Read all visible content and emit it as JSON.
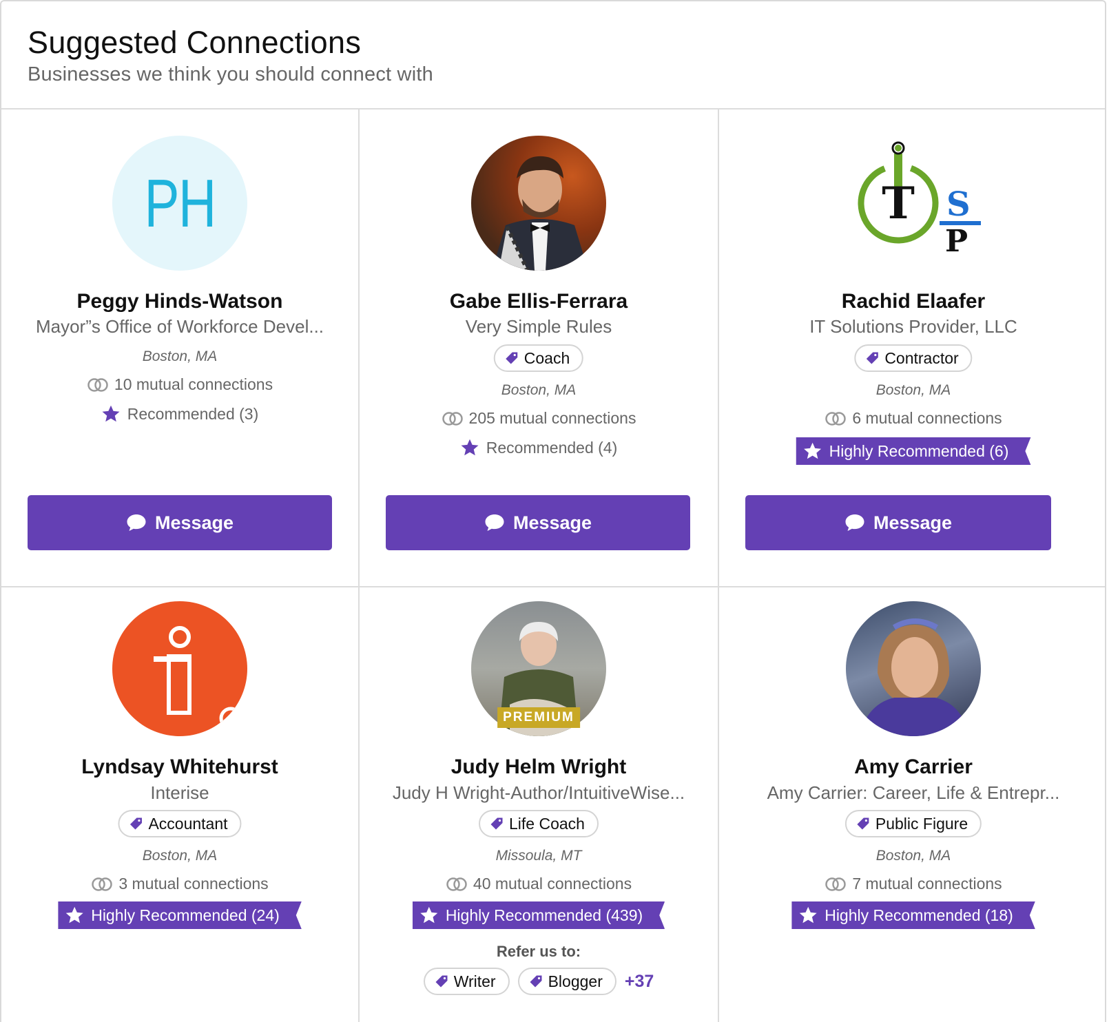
{
  "header": {
    "title": "Suggested Connections",
    "subtitle": "Businesses we think you should connect with"
  },
  "colors": {
    "accent": "#6440b4",
    "premium": "#c8a826",
    "text_muted": "#666666"
  },
  "message_label": "Message",
  "cards": [
    {
      "name": "Peggy Hinds-Watson",
      "org": "Mayor”s Office of Workforce Devel...",
      "location": "Boston, MA",
      "mutual": "10 mutual connections",
      "recommendation": "Recommended (3)",
      "avatar_initials": "PH"
    },
    {
      "name": "Gabe Ellis-Ferrara",
      "org": "Very Simple Rules",
      "tag": "Coach",
      "location": "Boston, MA",
      "mutual": "205 mutual connections",
      "recommendation": "Recommended (4)"
    },
    {
      "name": "Rachid Elaafer",
      "org": "IT Solutions Provider, LLC",
      "tag": "Contractor",
      "location": "Boston, MA",
      "mutual": "6 mutual connections",
      "recommendation": "Highly Recommended (6)",
      "logo_text": "T",
      "logo_side": "S",
      "logo_side2": "P"
    },
    {
      "name": "Lyndsay Whitehurst",
      "org": "Interise",
      "tag": "Accountant",
      "location": "Boston, MA",
      "mutual": "3 mutual connections",
      "recommendation": "Highly Recommended (24)"
    },
    {
      "name": "Judy Helm Wright",
      "org": "Judy H Wright-Author/IntuitiveWise...",
      "tag": "Life Coach",
      "location": "Missoula, MT",
      "mutual": "40 mutual connections",
      "recommendation": "Highly Recommended (439)",
      "badge": "PREMIUM",
      "refer_label": "Refer us to:",
      "refer_tags": [
        "Writer",
        "Blogger"
      ],
      "refer_more": "+37"
    },
    {
      "name": "Amy Carrier",
      "org": "Amy Carrier: Career, Life & Entrepr...",
      "tag": "Public Figure",
      "location": "Boston, MA",
      "mutual": "7 mutual connections",
      "recommendation": "Highly Recommended (18)"
    }
  ]
}
